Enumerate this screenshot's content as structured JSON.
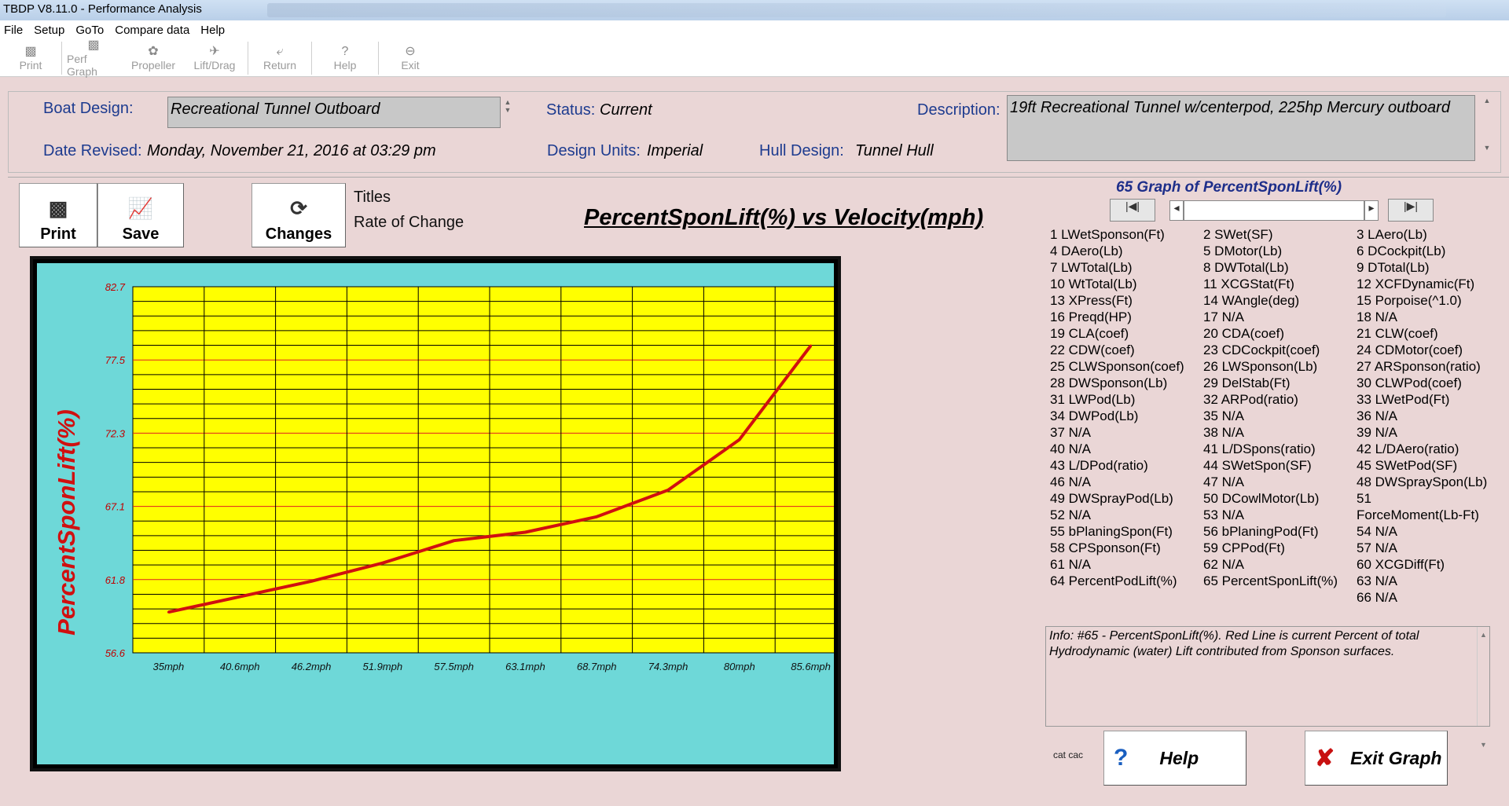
{
  "window": {
    "title": "TBDP V8.11.0 - Performance Analysis"
  },
  "menu": [
    "File",
    "Setup",
    "GoTo",
    "Compare data",
    "Help"
  ],
  "toolbar": [
    {
      "label": "Print",
      "icon": "printer-icon"
    },
    {
      "label": "Perf Graph",
      "icon": "chart-icon"
    },
    {
      "label": "Propeller",
      "icon": "propeller-icon"
    },
    {
      "label": "Lift/Drag",
      "icon": "liftdrag-icon"
    },
    {
      "label": "Return",
      "icon": "return-icon"
    },
    {
      "label": "Help",
      "icon": "question-icon"
    },
    {
      "label": "Exit",
      "icon": "exit-icon"
    }
  ],
  "info": {
    "boat_design_label": "Boat Design:",
    "boat_design_value": "Recreational Tunnel Outboard",
    "status_label": "Status:",
    "status_value": "Current",
    "description_label": "Description:",
    "description_value": "19ft Recreational Tunnel w/centerpod, 225hp Mercury outboard",
    "date_label": "Date Revised:",
    "date_value": "Monday, November 21, 2016 at 03:29 pm",
    "units_label": "Design Units:",
    "units_value": "Imperial",
    "hull_label": "Hull Design:",
    "hull_value": "Tunnel Hull"
  },
  "buttons": {
    "print": "Print",
    "save": "Save",
    "changes": "Changes",
    "titles": "Titles",
    "rate_of_change": "Rate of Change",
    "help": "Help",
    "exit_graph": "Exit Graph"
  },
  "graph_header": "65 Graph of PercentSponLift(%)",
  "params": [
    [
      "1 LWetSponson(Ft)",
      "4 DAero(Lb)",
      "7 LWTotal(Lb)",
      "10 WtTotal(Lb)",
      "13 XPress(Ft)",
      "16 Preqd(HP)",
      "19 CLA(coef)",
      "22 CDW(coef)",
      "25 CLWSponson(coef)",
      "28 DWSponson(Lb)",
      "31 LWPod(Lb)",
      "34 DWPod(Lb)",
      "37 N/A",
      "40 N/A",
      "43 L/DPod(ratio)",
      "46 N/A",
      "49 DWSprayPod(Lb)",
      "52 N/A",
      "55 bPlaningSpon(Ft)",
      "58 CPSponson(Ft)",
      "61 N/A",
      "64 PercentPodLift(%)"
    ],
    [
      "2 SWet(SF)",
      "5 DMotor(Lb)",
      "8 DWTotal(Lb)",
      "11 XCGStat(Ft)",
      "14 WAngle(deg)",
      "17 N/A",
      "20 CDA(coef)",
      "23 CDCockpit(coef)",
      "26 LWSponson(Lb)",
      "29 DelStab(Ft)",
      "32 ARPod(ratio)",
      "35 N/A",
      "38 N/A",
      "41 L/DSpons(ratio)",
      "44 SWetSpon(SF)",
      "47 N/A",
      "50 DCowlMotor(Lb)",
      "53 N/A",
      "56 bPlaningPod(Ft)",
      "59 CPPod(Ft)",
      "62 N/A",
      "65 PercentSponLift(%)"
    ],
    [
      "3 LAero(Lb)",
      "6 DCockpit(Lb)",
      "9 DTotal(Lb)",
      "12 XCFDynamic(Ft)",
      "15 Porpoise(^1.0)",
      "18 N/A",
      "21 CLW(coef)",
      "24 CDMotor(coef)",
      "27 ARSponson(ratio)",
      "30 CLWPod(coef)",
      "33 LWetPod(Ft)",
      "36 N/A",
      "39 N/A",
      "42 L/DAero(ratio)",
      "45 SWetPod(SF)",
      "48 DWSpraySpon(Lb)",
      "51",
      "ForceMoment(Lb-Ft)",
      "54 N/A",
      "57 N/A",
      "60 XCGDiff(Ft)",
      "63 N/A",
      "66 N/A"
    ]
  ],
  "info_text": "Info: #65 - PercentSponLift(%). Red Line is current Percent of total Hydrodynamic (water) Lift contributed from Sponson surfaces.",
  "cat_label": "cat cac",
  "chart_data": {
    "type": "line",
    "title": "PercentSponLift(%) vs Velocity(mph)",
    "ylabel": "PercentSponLift(%)",
    "xlabel": "",
    "categories": [
      "35mph",
      "40.6mph",
      "46.2mph",
      "51.9mph",
      "57.5mph",
      "63.1mph",
      "68.7mph",
      "74.3mph",
      "80mph",
      "85.6mph"
    ],
    "y_ticks": [
      "56.6",
      "61.8",
      "67.1",
      "72.3",
      "77.5",
      "82.7"
    ],
    "ylim": [
      56.6,
      82.7
    ],
    "series": [
      {
        "x": [
          35,
          40.6,
          46.2,
          51.9,
          57.5,
          63.1,
          68.7,
          74.3,
          80,
          85.6
        ],
        "values": [
          59.5,
          60.6,
          61.7,
          63.0,
          64.6,
          65.2,
          66.3,
          68.2,
          71.8,
          78.5
        ],
        "color": "#d01010"
      }
    ],
    "colors": {
      "plot_bg": "#ffff00",
      "frame_bg": "#6ed8d8",
      "line": "#d01010",
      "grid_v": "#000000",
      "grid_h_black": "#000000",
      "grid_h_red": "#e02020"
    }
  }
}
